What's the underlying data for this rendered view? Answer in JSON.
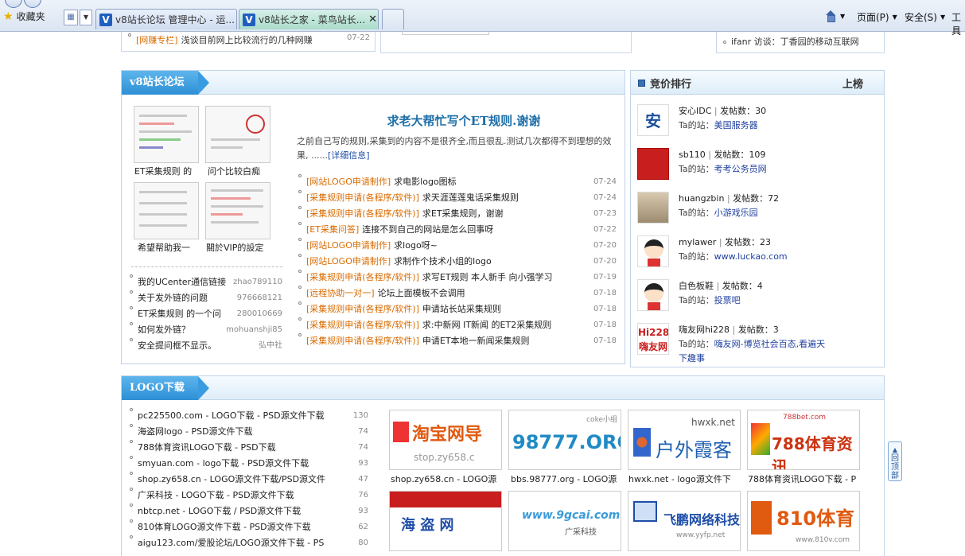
{
  "browser": {
    "favorites_label": "收藏夹",
    "tabs": [
      {
        "label": "v8站长论坛 管理中心 - 运..."
      },
      {
        "label": "v8站长之家 - 菜鸟站长..."
      }
    ],
    "menu": {
      "page": "页面(P)",
      "safety": "安全(S)",
      "tools": "工具"
    }
  },
  "top_remnant": {
    "left_item": {
      "tag": "[网赚专栏]",
      "title": "浅谈目前网上比较流行的几种网赚",
      "date": "07-22"
    },
    "right_item": {
      "title": "ifanr 访谈：丁香园的移动互联网"
    }
  },
  "forum": {
    "title": "v8站长论坛",
    "thumbs": [
      {
        "caption": "ET采集规则 的"
      },
      {
        "caption": "问个比较白痴"
      },
      {
        "caption": "希望帮助我一"
      },
      {
        "caption": "關於VIP的設定"
      }
    ],
    "featured": {
      "title": "求老大帮忙写个ET规则.谢谢",
      "desc": "之前自己写的规则,采集到的内容不是很齐全,而且很乱.测试几次都得不到理想的效果, ......",
      "link": "[详细信息]"
    },
    "posts": [
      {
        "tag": "[网站LOGO申请制作]",
        "title": "求电影logo图标",
        "date": "07-24"
      },
      {
        "tag": "[采集规则申请(各程序/软件)]",
        "title": "求天涯莲莲鬼话采集规则",
        "date": "07-24"
      },
      {
        "tag": "[采集规则申请(各程序/软件)]",
        "title": "求ET采集规则，谢谢",
        "date": "07-23"
      },
      {
        "tag": "[ET采集问答]",
        "title": "连接不到自己的网站是怎么回事呀",
        "date": "07-22"
      },
      {
        "tag": "[网站LOGO申请制作]",
        "title": "求logo呀~",
        "date": "07-20"
      },
      {
        "tag": "[网站LOGO申请制作]",
        "title": "求制作个技术小组的logo",
        "date": "07-20"
      },
      {
        "tag": "[采集规则申请(各程序/软件)]",
        "title": "求写ET规则 本人新手 向小强学习",
        "date": "07-19"
      },
      {
        "tag": "[远程协助一对一]",
        "title": "论坛上面模板不会调用",
        "date": "07-18"
      },
      {
        "tag": "[采集规则申请(各程序/软件)]",
        "title": "申请站长站采集规则",
        "date": "07-18"
      },
      {
        "tag": "[采集规则申请(各程序/软件)]",
        "title": "求:中新网 IT新闻 的ET2采集规则",
        "date": "07-18"
      },
      {
        "tag": "[采集规则申请(各程序/软件)]",
        "title": "申请ET本地一新闻采集规则",
        "date": "07-18"
      }
    ],
    "small_list": [
      {
        "title": "我的UCenter通信链接",
        "user": "zhao789110"
      },
      {
        "title": "关于发外链的问题",
        "user": "976668121"
      },
      {
        "title": "ET采集规则 的一个问",
        "user": "280010669"
      },
      {
        "title": "如何发外链？",
        "user": "mohuanshji85"
      },
      {
        "title": "安全提问框不显示。",
        "user": "弘中社"
      }
    ]
  },
  "ranking": {
    "title": "竞价排行",
    "action": "上榜",
    "posts_label": "发帖数：",
    "site_label": "Ta的站：",
    "items": [
      {
        "name": "安心IDC",
        "posts": "30",
        "site": "美国服务器"
      },
      {
        "name": "sb110",
        "posts": "109",
        "site": "考考公务员网"
      },
      {
        "name": "huangzbin",
        "posts": "72",
        "site": "小游戏乐园"
      },
      {
        "name": "mylawer",
        "posts": "23",
        "site": "www.luckao.com"
      },
      {
        "name": "白色板鞋",
        "posts": "4",
        "site": "投票吧"
      },
      {
        "name": "嗨友网hi228",
        "posts": "3",
        "site": "嗨友网-博览社会百态,看遍天下趣事"
      }
    ]
  },
  "logo": {
    "title": "LOGO下载",
    "list": [
      {
        "title": "pc225500.com - LOGO下载 - PSD源文件下载",
        "count": "130"
      },
      {
        "title": "海盗网logo - PSD源文件下载",
        "count": "74"
      },
      {
        "title": "788体育资讯LOGO下载 - PSD下载",
        "count": "74"
      },
      {
        "title": "smyuan.com - logo下载 - PSD源文件下载",
        "count": "93"
      },
      {
        "title": "shop.zy658.cn - LOGO源文件下载/PSD源文件",
        "count": "47"
      },
      {
        "title": "广采科技 - LOGO下载 - PSD源文件下载",
        "count": "76"
      },
      {
        "title": "nbtcp.net - LOGO下载 / PSD源文件下载",
        "count": "93"
      },
      {
        "title": "810体育LOGO源文件下载 - PSD源文件下载",
        "count": "62"
      },
      {
        "title": "aigu123.com/爱股论坛/LOGO源文件下载 - PS",
        "count": "80"
      }
    ],
    "tiles": [
      {
        "caption": "shop.zy658.cn - LOGO源",
        "text": "淘宝网导",
        "sub": "stop.zy658.c"
      },
      {
        "caption": "bbs.98777.org - LOGO源",
        "text": "98777.ORG",
        "sub": "coke小组"
      },
      {
        "caption": "hwxk.net - logo源文件下",
        "text": "户外霞客",
        "sub": "hwxk.net"
      },
      {
        "caption": "788体育资讯LOGO下载 - P",
        "text": "788体育资讯",
        "sub": "788bet.com"
      },
      {
        "caption": "",
        "text": "海 盗 网",
        "sub": ""
      },
      {
        "caption": "",
        "text": "www.9gcai.com",
        "sub": "广采科技"
      },
      {
        "caption": "",
        "text": "飞鹏网络科技",
        "sub": "www.yyfp.net"
      },
      {
        "caption": "",
        "text": "810体育",
        "sub": "www.810v.com"
      }
    ]
  },
  "back_top": "回顶部"
}
